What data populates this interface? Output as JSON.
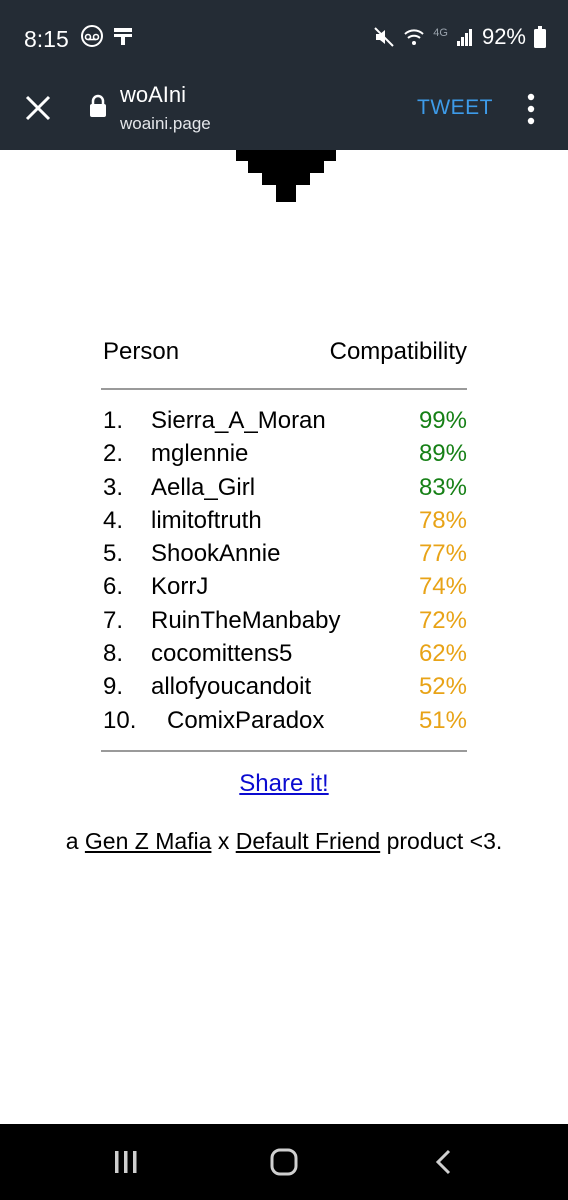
{
  "status": {
    "time": "8:15",
    "net": "4G",
    "battery": "92%"
  },
  "appbar": {
    "title": "woAIni",
    "url": "woaini.page",
    "tweet": "TWEET"
  },
  "table": {
    "header_person": "Person",
    "header_compat": "Compatibility",
    "rows": [
      {
        "rank": "1.",
        "name": "Sierra_A_Moran",
        "pct": "99%",
        "color": "#168016"
      },
      {
        "rank": "2.",
        "name": "mglennie",
        "pct": "89%",
        "color": "#168016"
      },
      {
        "rank": "3.",
        "name": "Aella_Girl",
        "pct": "83%",
        "color": "#168016"
      },
      {
        "rank": "4.",
        "name": "limitoftruth",
        "pct": "78%",
        "color": "#e8a317"
      },
      {
        "rank": "5.",
        "name": "ShookAnnie",
        "pct": "77%",
        "color": "#e8a317"
      },
      {
        "rank": "6.",
        "name": "KorrJ",
        "pct": "74%",
        "color": "#e8a317"
      },
      {
        "rank": "7.",
        "name": "RuinTheManbaby",
        "pct": "72%",
        "color": "#e8a317"
      },
      {
        "rank": "8.",
        "name": "cocomittens5",
        "pct": "62%",
        "color": "#e8a317"
      },
      {
        "rank": "9.",
        "name": "allofyoucandoit",
        "pct": "52%",
        "color": "#e8a317"
      },
      {
        "rank": "10.",
        "name": "ComixParadox",
        "pct": "51%",
        "color": "#e8a317"
      }
    ]
  },
  "share": "Share it!",
  "footer": {
    "pre": "a ",
    "link1": "Gen Z Mafia",
    "mid": " x ",
    "link2": "Default Friend",
    "post": " product <3."
  },
  "colors": {
    "bar": "#242c35",
    "accent": "#3d9be9",
    "green": "#168016",
    "orange": "#e8a317",
    "link": "#0b0bd0"
  }
}
